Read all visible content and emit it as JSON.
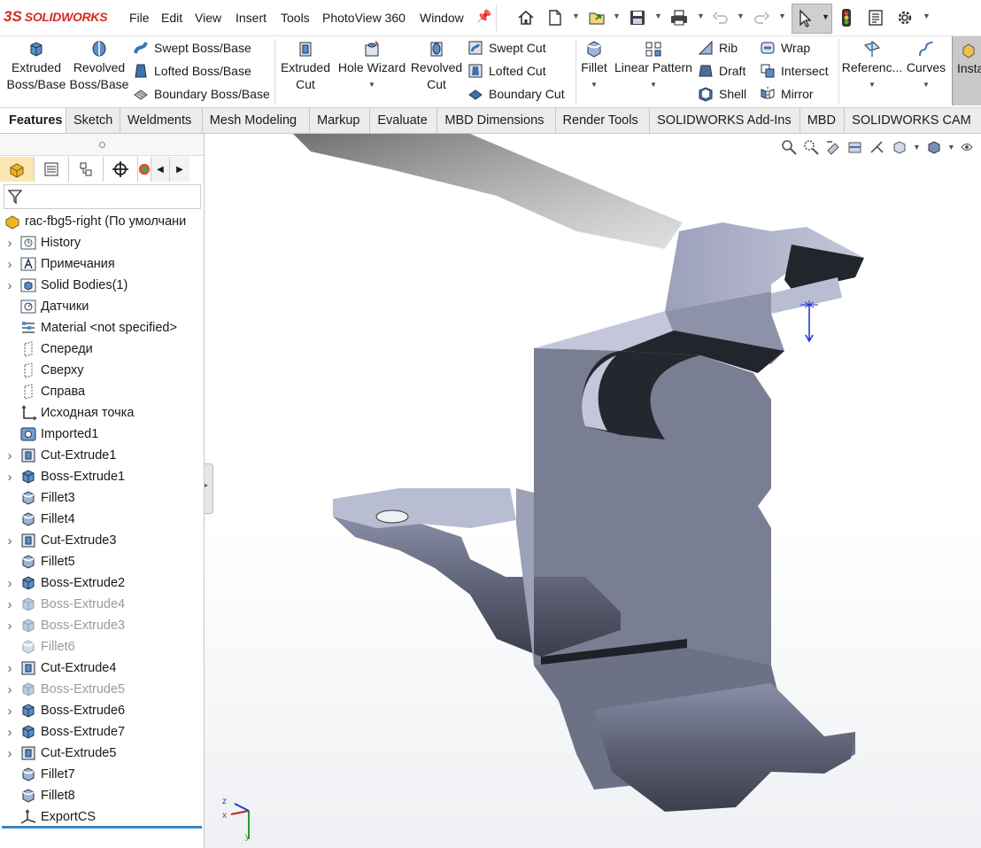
{
  "app": {
    "logo_prefix": "3S",
    "logo_name": "SOLIDWORKS"
  },
  "menu": [
    "File",
    "Edit",
    "View",
    "Insert",
    "Tools",
    "PhotoView 360",
    "Window"
  ],
  "quick_access_icons": [
    "home-icon",
    "new-document-icon",
    "open-icon",
    "save-icon",
    "print-icon",
    "undo-icon",
    "redo-icon",
    "select-icon",
    "traffic-light-icon",
    "file-properties-icon",
    "options-gear-icon"
  ],
  "ribbon": {
    "extruded_boss": [
      "Extruded",
      "Boss/Base"
    ],
    "revolved_boss": [
      "Revolved",
      "Boss/Base"
    ],
    "swept_boss": "Swept Boss/Base",
    "lofted_boss": "Lofted Boss/Base",
    "boundary_boss": "Boundary Boss/Base",
    "extruded_cut": [
      "Extruded",
      "Cut"
    ],
    "hole_wizard": "Hole Wizard",
    "revolved_cut": [
      "Revolved",
      "Cut"
    ],
    "swept_cut": "Swept Cut",
    "lofted_cut": "Lofted Cut",
    "boundary_cut": "Boundary Cut",
    "fillet": "Fillet",
    "linear_pattern": "Linear Pattern",
    "rib": "Rib",
    "draft": "Draft",
    "shell": "Shell",
    "wrap": "Wrap",
    "intersect": "Intersect",
    "mirror": "Mirror",
    "reference": "Referenc...",
    "curves": "Curves",
    "instant3d": "Insta"
  },
  "tabs": [
    {
      "label": "Features",
      "active": true
    },
    {
      "label": "Sketch"
    },
    {
      "label": "Weldments"
    },
    {
      "label": "Mesh Modeling"
    },
    {
      "label": "Markup"
    },
    {
      "label": "Evaluate"
    },
    {
      "label": "MBD Dimensions"
    },
    {
      "label": "Render Tools"
    },
    {
      "label": "SOLIDWORKS Add-Ins"
    },
    {
      "label": "MBD"
    },
    {
      "label": "SOLIDWORKS CAM"
    }
  ],
  "tree": {
    "root": "rac-fbg5-right  (По умолчани",
    "items": [
      {
        "label": "History",
        "arrow": true,
        "icon": "history-icon",
        "suppressed": false
      },
      {
        "label": "Примечания",
        "arrow": true,
        "icon": "annotations-icon",
        "suppressed": false
      },
      {
        "label": "Solid Bodies(1)",
        "arrow": true,
        "icon": "solid-bodies-icon",
        "suppressed": false
      },
      {
        "label": "Датчики",
        "arrow": false,
        "icon": "sensors-icon",
        "suppressed": false
      },
      {
        "label": "Material <not specified>",
        "arrow": false,
        "icon": "material-icon",
        "suppressed": false
      },
      {
        "label": "Спереди",
        "arrow": false,
        "icon": "plane-icon",
        "suppressed": false
      },
      {
        "label": "Сверху",
        "arrow": false,
        "icon": "plane-icon",
        "suppressed": false
      },
      {
        "label": "Справа",
        "arrow": false,
        "icon": "plane-icon",
        "suppressed": false
      },
      {
        "label": "Исходная точка",
        "arrow": false,
        "icon": "origin-icon",
        "suppressed": false
      },
      {
        "label": "Imported1",
        "arrow": false,
        "icon": "imported-body-icon",
        "suppressed": false
      },
      {
        "label": "Cut-Extrude1",
        "arrow": true,
        "icon": "cut-extrude-icon",
        "suppressed": false
      },
      {
        "label": "Boss-Extrude1",
        "arrow": true,
        "icon": "boss-extrude-icon",
        "suppressed": false
      },
      {
        "label": "Fillet3",
        "arrow": false,
        "icon": "fillet-icon",
        "suppressed": false
      },
      {
        "label": "Fillet4",
        "arrow": false,
        "icon": "fillet-icon",
        "suppressed": false
      },
      {
        "label": "Cut-Extrude3",
        "arrow": true,
        "icon": "cut-extrude-icon",
        "suppressed": false
      },
      {
        "label": "Fillet5",
        "arrow": false,
        "icon": "fillet-icon",
        "suppressed": false
      },
      {
        "label": "Boss-Extrude2",
        "arrow": true,
        "icon": "boss-extrude-icon",
        "suppressed": false
      },
      {
        "label": "Boss-Extrude4",
        "arrow": true,
        "icon": "boss-extrude-icon",
        "suppressed": true
      },
      {
        "label": "Boss-Extrude3",
        "arrow": true,
        "icon": "boss-extrude-icon",
        "suppressed": true
      },
      {
        "label": "Fillet6",
        "arrow": false,
        "icon": "fillet-icon",
        "suppressed": true
      },
      {
        "label": "Cut-Extrude4",
        "arrow": true,
        "icon": "cut-extrude-icon",
        "suppressed": false
      },
      {
        "label": "Boss-Extrude5",
        "arrow": true,
        "icon": "boss-extrude-icon",
        "suppressed": true
      },
      {
        "label": "Boss-Extrude6",
        "arrow": true,
        "icon": "boss-extrude-icon",
        "suppressed": false
      },
      {
        "label": "Boss-Extrude7",
        "arrow": true,
        "icon": "boss-extrude-icon",
        "suppressed": false
      },
      {
        "label": "Cut-Extrude5",
        "arrow": true,
        "icon": "cut-extrude-icon",
        "suppressed": false
      },
      {
        "label": "Fillet7",
        "arrow": false,
        "icon": "fillet-icon",
        "suppressed": false
      },
      {
        "label": "Fillet8",
        "arrow": false,
        "icon": "fillet-icon",
        "suppressed": false
      },
      {
        "label": "ExportCS",
        "arrow": false,
        "icon": "coordinate-system-icon",
        "suppressed": false
      }
    ]
  },
  "triad": {
    "x": "x",
    "y": "y",
    "z": "z"
  },
  "colors": {
    "brand": "#d52b1e",
    "part_face": "#a9adc4",
    "part_dark": "#2a2c33",
    "tab_active": "#fbe6b2",
    "selection_blue": "#3b86c4"
  }
}
